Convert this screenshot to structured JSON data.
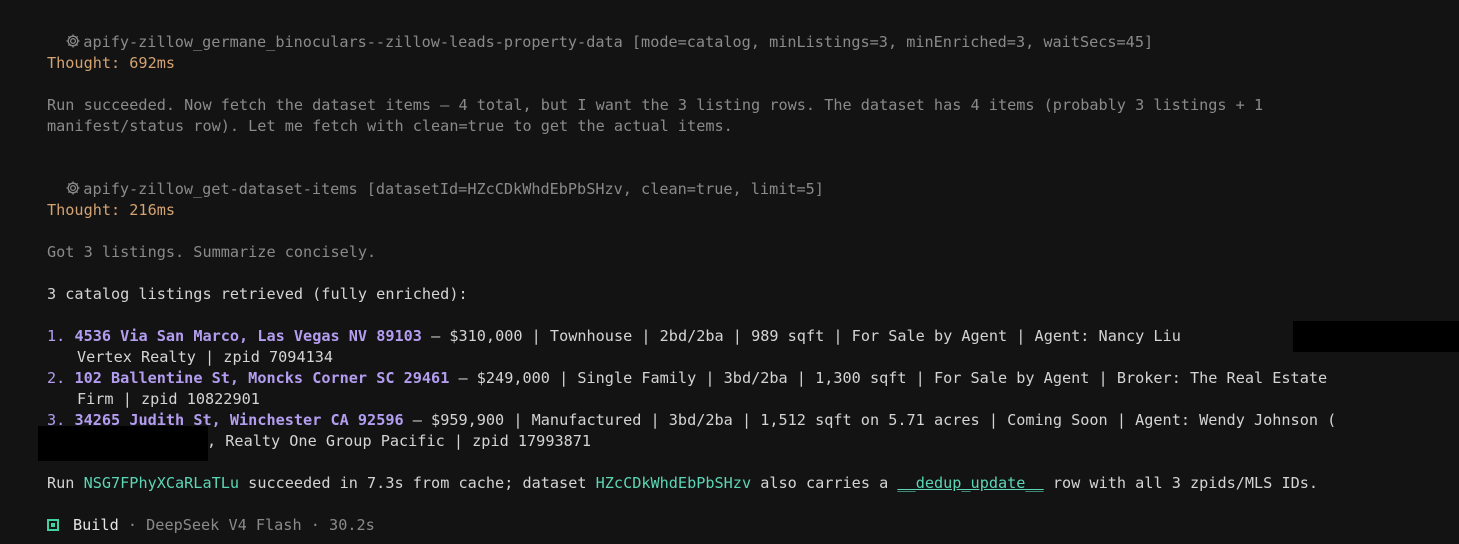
{
  "tool_call_1": {
    "icon": "gear-icon",
    "text": "apify-zillow_germane_binoculars--zillow-leads-property-data [mode=catalog, minListings=3, minEnriched=3, waitSecs=45]"
  },
  "thought_1": "Thought: 692ms",
  "reasoning_1": {
    "line1": "Run succeeded. Now fetch the dataset items — 4 total, but I want the 3 listing rows. The dataset has 4 items (probably 3 listings + 1",
    "line2": "manifest/status row). Let me fetch with clean=true to get the actual items."
  },
  "tool_call_2": {
    "icon": "gear-icon",
    "text": "apify-zillow_get-dataset-items [datasetId=HZcCDkWhdEbPbSHzv, clean=true, limit=5]"
  },
  "thought_2": "Thought: 216ms",
  "reasoning_2": "Got 3 listings. Summarize concisely.",
  "summary_heading": "3 catalog listings retrieved (fully enriched):",
  "listings": [
    {
      "num": "1.",
      "address": "4536 Via San Marco, Las Vegas NV 89103",
      "details1": " — $310,000 | Townhouse | 2bd/2ba | 989 sqft | For Sale by Agent | Agent: Nancy Liu",
      "details2": "Vertex Realty | zpid 7094134"
    },
    {
      "num": "2.",
      "address": "102 Ballentine St, Moncks Corner SC 29461",
      "details1": " — $249,000 | Single Family | 3bd/2ba | 1,300 sqft | For Sale by Agent | Broker: The Real Estate",
      "details2": "Firm | zpid 10822901"
    },
    {
      "num": "3.",
      "address": "34265 Judith St, Winchester CA 92596",
      "details1": " — $959,900 | Manufactured | 3bd/2ba | 1,512 sqft on 5.71 acres | Coming Soon | Agent: Wendy Johnson (",
      "details2": ", Realty One Group Pacific | zpid 17993871"
    }
  ],
  "run_summary": {
    "prefix": "Run ",
    "run_id": "NSG7FPhyXCaRLaTLu",
    "middle": " succeeded in 7.3s from cache; dataset ",
    "dataset_id": "HZcCDkWhdEbPbSHzv",
    "middle2": " also carries a ",
    "row_name": "__dedup_update__",
    "suffix": " row with all 3 zpids/MLS IDs."
  },
  "footer": {
    "mode": "Build",
    "separator1": " · ",
    "model": "DeepSeek V4 Flash",
    "separator2": " · ",
    "duration": "30.2s"
  },
  "colors": {
    "background": "#131313",
    "thought": "#d4a373",
    "listing_accent": "#b39df0",
    "id_accent": "#5cd6b4",
    "build_accent": "#3fd1a0"
  }
}
